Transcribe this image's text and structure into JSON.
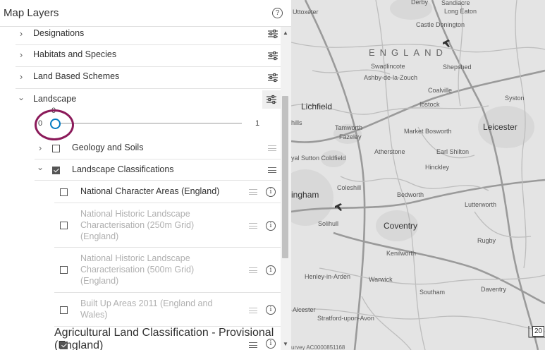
{
  "panel": {
    "title": "Map Layers",
    "help_glyph": "?"
  },
  "layers": {
    "designations": "Designations",
    "habitats": "Habitats and Species",
    "land_schemes": "Land Based Schemes",
    "landscape": "Landscape",
    "geology": "Geology and Soils",
    "landscape_classifications": "Landscape Classifications",
    "nca": "National Character Areas (England)",
    "nhlc_250": "National Historic Landscape Characterisation (250m Grid) (England)",
    "nhlc_500": "National Historic Landscape Characterisation (500m Grid) (England)",
    "built_up": "Built Up Areas 2011 (England and Wales)",
    "alc": "Agricultural Land Classification - Provisional (England)"
  },
  "slider": {
    "value": "0",
    "min": "0",
    "max": "1",
    "fraction": 0
  },
  "icons": {
    "chevron_right": "›",
    "chevron_down": "⌄",
    "info": "i",
    "scroll_up": "▲",
    "scroll_down": "▼"
  },
  "map": {
    "places": {
      "derby": "Derby",
      "sandiacre": "Sandiacre",
      "uttoxeter": "Uttoxeter",
      "long_eaton": "Long Eaton",
      "castle_donington": "Castle Donington",
      "england": "ENGLAND",
      "swadlincote": "Swadlincote",
      "ashby": "Ashby-de-la-Zouch",
      "shepshed": "Shepshed",
      "coalville": "Coalville",
      "lichfield": "Lichfield",
      "ibstock": "Ibstock",
      "syston": "Syston",
      "hills": "hills",
      "tamworth": "Tamworth",
      "fazeley": "Fazeley",
      "market_bosworth": "Market Bosworth",
      "leicester": "Leicester",
      "sutton_coldfield": "yal Sutton Coldfield",
      "atherstone": "Atherstone",
      "earl_shilton": "Earl Shilton",
      "hinckley": "Hinckley",
      "coleshill": "Coleshill",
      "birmingham": "ingham",
      "bedworth": "Bedworth",
      "lutterworth": "Lutterworth",
      "solihull": "Solihull",
      "coventry": "Coventry",
      "kenilworth": "Kenilworth",
      "rugby": "Rugby",
      "henley": "Henley-in-Arden",
      "warwick": "Warwick",
      "daventry": "Daventry",
      "southam": "Southam",
      "alcester": "Alcester",
      "stratford": "Stratford-upon-Avon"
    },
    "copyright": "urvey AC0000851168",
    "scale": "20"
  }
}
